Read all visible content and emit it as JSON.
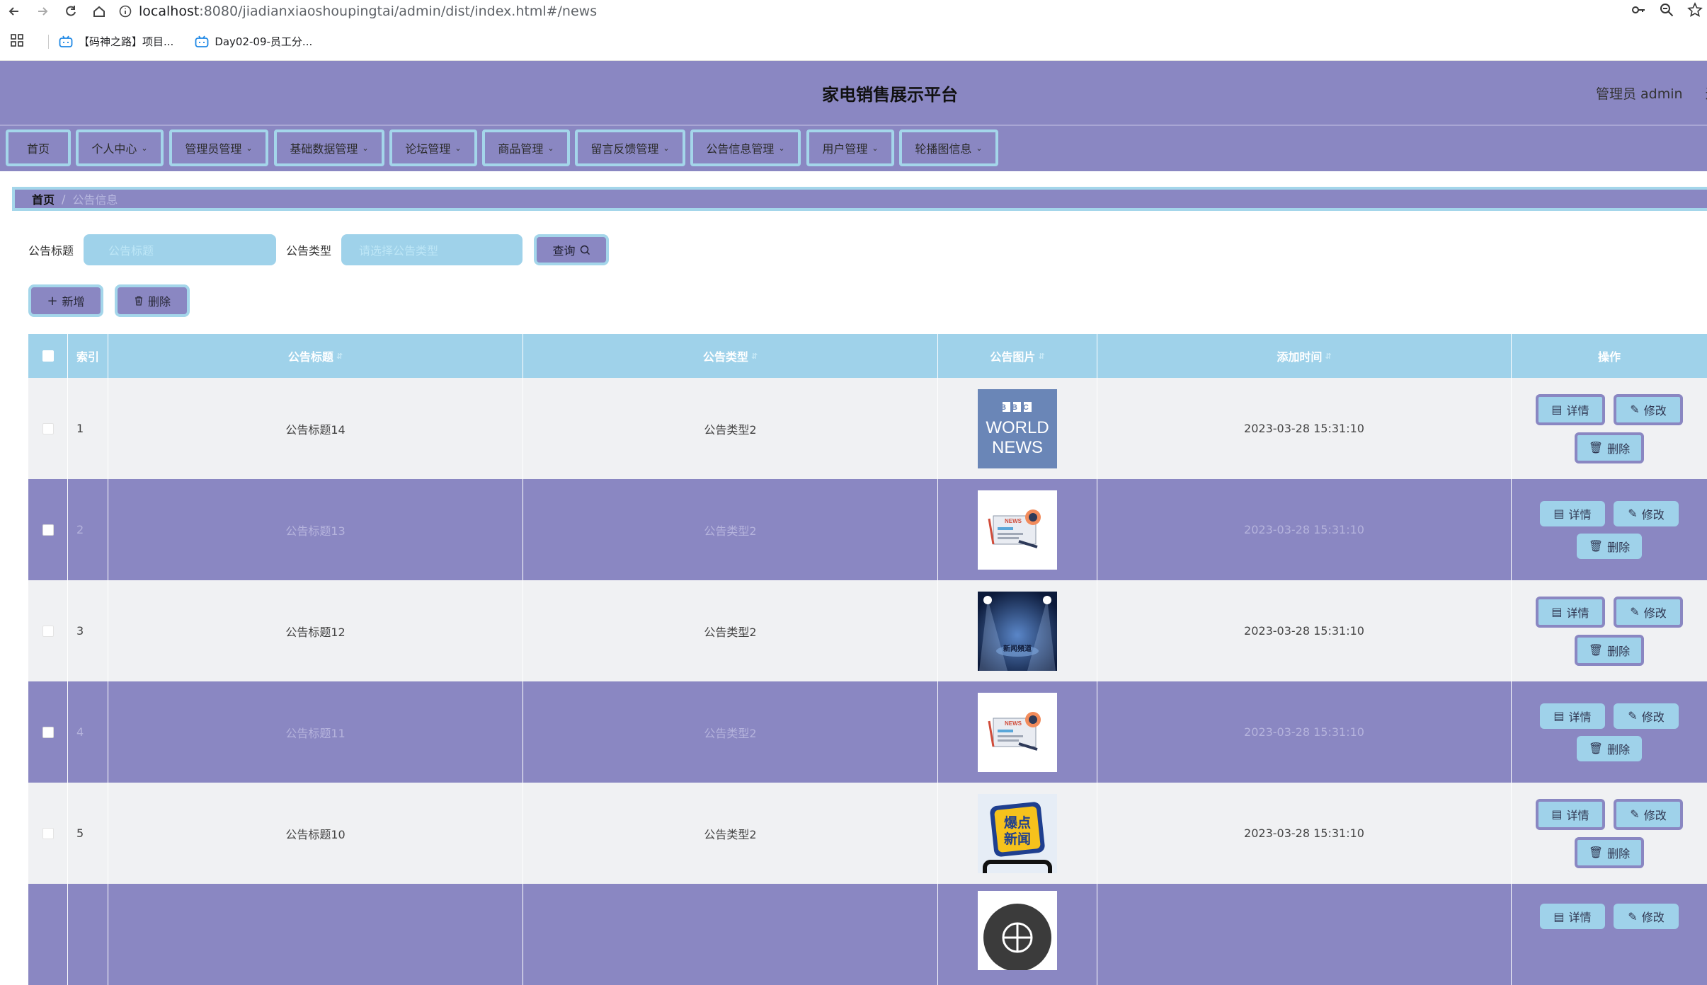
{
  "browser": {
    "url_host": "localhost",
    "url_path": ":8080/jiadianxiaoshoupingtai/admin/dist/index.html#/news",
    "bookmarks": [
      "【码神之路】项目...",
      "Day02-09-员工分..."
    ]
  },
  "header": {
    "title": "家电销售展示平台",
    "user": "管理员 admin",
    "logout_partial": "退"
  },
  "menu": [
    {
      "label": "首页",
      "has_dropdown": false
    },
    {
      "label": "个人中心",
      "has_dropdown": true
    },
    {
      "label": "管理员管理",
      "has_dropdown": true
    },
    {
      "label": "基础数据管理",
      "has_dropdown": true
    },
    {
      "label": "论坛管理",
      "has_dropdown": true
    },
    {
      "label": "商品管理",
      "has_dropdown": true
    },
    {
      "label": "留言反馈管理",
      "has_dropdown": true
    },
    {
      "label": "公告信息管理",
      "has_dropdown": true
    },
    {
      "label": "用户管理",
      "has_dropdown": true
    },
    {
      "label": "轮播图信息",
      "has_dropdown": true
    }
  ],
  "breadcrumb": {
    "home": "首页",
    "sep": "/",
    "current": "公告信息"
  },
  "search": {
    "title_label": "公告标题",
    "title_placeholder": "公告标题",
    "type_label": "公告类型",
    "type_placeholder": "请选择公告类型",
    "search_button": "查询"
  },
  "actions": {
    "add": "新增",
    "delete": "删除"
  },
  "table": {
    "headers": {
      "index": "索引",
      "title": "公告标题",
      "type": "公告类型",
      "image": "公告图片",
      "time": "添加时间",
      "ops": "操作"
    },
    "op_labels": {
      "detail": "详情",
      "edit": "修改",
      "delete": "删除"
    },
    "rows": [
      {
        "index": "1",
        "title": "公告标题14",
        "type": "公告类型2",
        "image": "bbc-world-news",
        "time": "2023-03-28 15:31:10"
      },
      {
        "index": "2",
        "title": "公告标题13",
        "type": "公告类型2",
        "image": "news-paper",
        "time": "2023-03-28 15:31:10"
      },
      {
        "index": "3",
        "title": "公告标题12",
        "type": "公告类型2",
        "image": "stage-spotlight",
        "time": "2023-03-28 15:31:10"
      },
      {
        "index": "4",
        "title": "公告标题11",
        "type": "公告类型2",
        "image": "news-paper",
        "time": "2023-03-28 15:31:10"
      },
      {
        "index": "5",
        "title": "公告标题10",
        "type": "公告类型2",
        "image": "breaking-news-phone",
        "time": "2023-03-28 15:31:10"
      }
    ]
  },
  "image_text": {
    "bbc": "BBC",
    "world": "WORLD",
    "news": "NEWS",
    "small_news": "NEWS",
    "stage": "新闻頻道",
    "breaking_1": "爆点",
    "breaking_2": "新闻"
  },
  "colors": {
    "theme": "#8a87c2",
    "accent": "#9fd2ea",
    "border": "#a4d6ea"
  }
}
